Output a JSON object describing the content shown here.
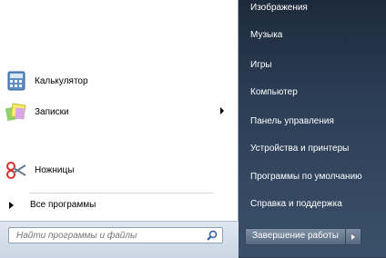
{
  "programs": [
    {
      "label": "Калькулятор",
      "icon": "calculator-icon",
      "has_submenu": false
    },
    {
      "label": "Записки",
      "icon": "sticky-notes-icon",
      "has_submenu": true
    },
    {
      "label": "Ножницы",
      "icon": "scissors-icon",
      "has_submenu": false
    }
  ],
  "all_programs": {
    "label": "Все программы"
  },
  "search": {
    "placeholder": "Найти программы и файлы"
  },
  "right_menu": [
    {
      "label": "Изображения"
    },
    {
      "label": "Музыка"
    },
    {
      "label": "Игры"
    },
    {
      "label": "Компьютер"
    },
    {
      "label": "Панель управления"
    },
    {
      "label": "Устройства и принтеры"
    },
    {
      "label": "Программы по умолчанию"
    },
    {
      "label": "Справка и поддержка"
    }
  ],
  "shutdown": {
    "label": "Завершение работы"
  },
  "colors": {
    "right_panel": "#2c3e56",
    "left_panel": "#ffffff"
  }
}
